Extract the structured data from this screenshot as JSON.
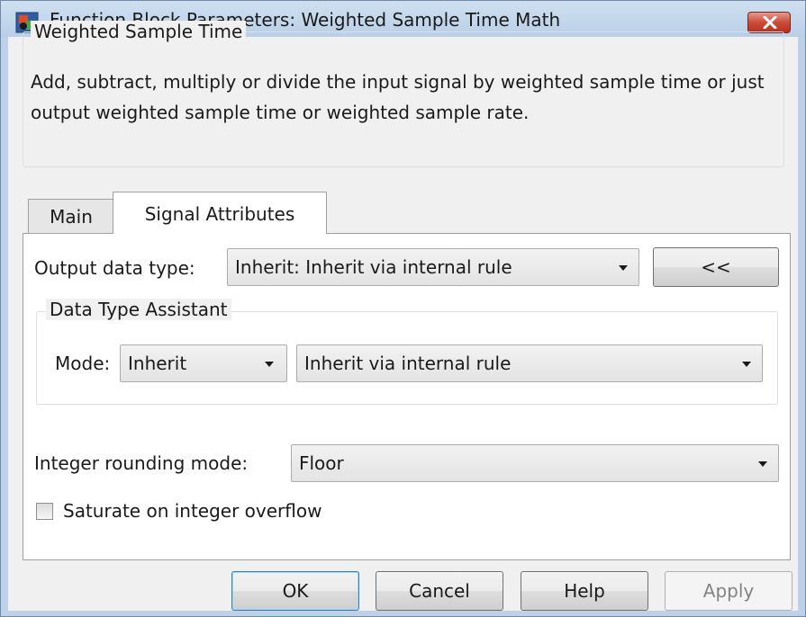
{
  "window": {
    "title": "Function Block Parameters: Weighted Sample Time Math"
  },
  "description": {
    "group_title": "Weighted Sample Time",
    "text": "Add, subtract, multiply or divide the input signal by weighted sample time or just output weighted sample time or weighted sample rate."
  },
  "tabs": [
    {
      "label": "Main",
      "selected": false
    },
    {
      "label": "Signal Attributes",
      "selected": true
    }
  ],
  "signal_attributes": {
    "output_data_type_label": "Output data type:",
    "output_data_type_value": "Inherit: Inherit via internal rule",
    "assistant_toggle_label": "<<",
    "data_type_assistant": {
      "group_title": "Data Type Assistant",
      "mode_label": "Mode:",
      "mode_value": "Inherit",
      "rule_value": "Inherit via internal rule"
    },
    "rounding_label": "Integer rounding mode:",
    "rounding_value": "Floor",
    "saturate_label": "Saturate on integer overflow",
    "saturate_checked": false
  },
  "buttons": {
    "ok": "OK",
    "cancel": "Cancel",
    "help": "Help",
    "apply": "Apply"
  },
  "colors": {
    "title_bar": "#bdd2e8",
    "close_button": "#cc4b38",
    "dialog_background": "#f0f0f0"
  }
}
